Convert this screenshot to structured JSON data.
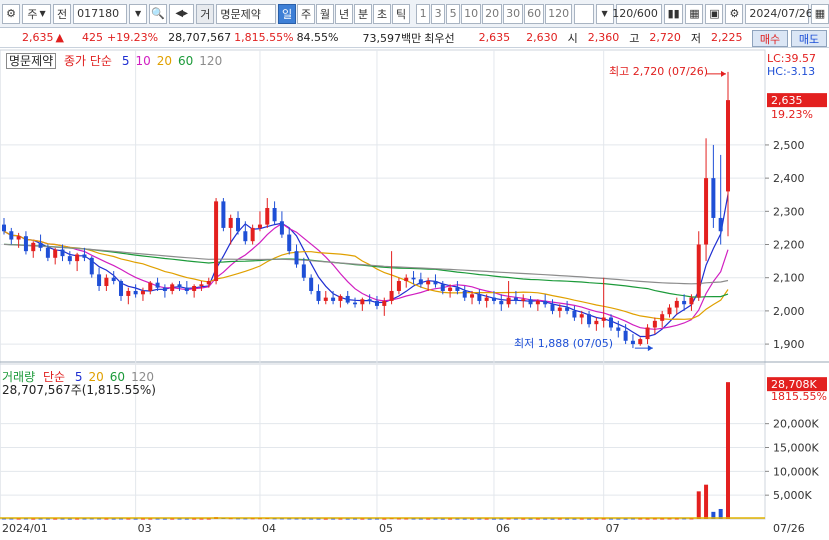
{
  "toolbar": {
    "market": "주",
    "type": "전",
    "code": "017180",
    "name_prefix": "거",
    "name": "명문제약",
    "periods": [
      "일",
      "주",
      "월",
      "년",
      "분",
      "초",
      "틱"
    ],
    "selected_period": "일",
    "intervals": [
      "1",
      "3",
      "5",
      "10",
      "20",
      "30",
      "60",
      "120"
    ],
    "count": "120/600",
    "date": "2024/07/26"
  },
  "quote": {
    "price": "2,635",
    "arrow": "▲",
    "change": "425",
    "change_pct": "+19.23%",
    "volume": "28,707,567",
    "volume_ratio": "1,815.55%",
    "turnover": "84.55%",
    "amount": "73,597백만",
    "ask_label": "최우선",
    "ask": "2,635",
    "bid": "2,630",
    "open_label": "시",
    "open": "2,360",
    "high_label": "고",
    "high": "2,720",
    "low_label": "저",
    "low": "2,225",
    "buy": "매수",
    "sell": "매도"
  },
  "price_panel": {
    "name": "명문제약",
    "legend_label": "종가 단순",
    "ma": [
      {
        "label": "5",
        "color": "#1f2fd1"
      },
      {
        "label": "10",
        "color": "#d11fc1"
      },
      {
        "label": "20",
        "color": "#e0a000"
      },
      {
        "label": "60",
        "color": "#1c9a3a"
      },
      {
        "label": "120",
        "color": "#8c8c8c"
      }
    ],
    "high_note": "최고 2,720 (07/26)",
    "low_note": "최저 1,888 (07/05)",
    "lc": "LC:39.57",
    "hc": "HC:-3.13",
    "current_price": "2,635",
    "current_pct": "19.23%"
  },
  "volume_panel": {
    "name": "거래량",
    "legend_label": "단순",
    "ma": [
      {
        "label": "5",
        "color": "#1f2fd1"
      },
      {
        "label": "20",
        "color": "#e0a000"
      },
      {
        "label": "60",
        "color": "#1c9a3a"
      },
      {
        "label": "120",
        "color": "#8c8c8c"
      }
    ],
    "last": "28,707,567주(1,815.55%)",
    "current": "28,708K",
    "current_pct": "1815.55%"
  },
  "x_axis": {
    "labels": [
      "2024/01",
      "03",
      "04",
      "05",
      "06",
      "07"
    ],
    "right_label": "07/26"
  },
  "chart_data": {
    "type": "candlestick",
    "price_axis": {
      "ticks": [
        1900,
        2000,
        2100,
        2200,
        2300,
        2400,
        2500
      ],
      "tick_labels": [
        "1,900",
        "2,000",
        "2,100",
        "2,200",
        "2,300",
        "2,400",
        "2,500"
      ],
      "ylim": [
        1840,
        2780
      ]
    },
    "volume_axis": {
      "ticks": [
        5000,
        10000,
        15000,
        20000
      ],
      "tick_labels": [
        "5,000K",
        "10,000K",
        "15,000K",
        "20,000K"
      ],
      "ylim": [
        0,
        30000
      ]
    },
    "candles": [
      [
        2260,
        2280,
        2230,
        2240
      ],
      [
        2240,
        2250,
        2200,
        2215
      ],
      [
        2215,
        2235,
        2190,
        2225
      ],
      [
        2225,
        2240,
        2170,
        2180
      ],
      [
        2180,
        2210,
        2160,
        2205
      ],
      [
        2205,
        2230,
        2180,
        2190
      ],
      [
        2190,
        2200,
        2150,
        2160
      ],
      [
        2160,
        2190,
        2140,
        2185
      ],
      [
        2185,
        2200,
        2150,
        2165
      ],
      [
        2165,
        2180,
        2140,
        2150
      ],
      [
        2150,
        2175,
        2120,
        2170
      ],
      [
        2170,
        2190,
        2150,
        2160
      ],
      [
        2160,
        2165,
        2100,
        2110
      ],
      [
        2110,
        2130,
        2060,
        2075
      ],
      [
        2075,
        2110,
        2060,
        2100
      ],
      [
        2100,
        2120,
        2080,
        2090
      ],
      [
        2090,
        2095,
        2030,
        2045
      ],
      [
        2045,
        2070,
        2020,
        2060
      ],
      [
        2060,
        2080,
        2040,
        2050
      ],
      [
        2050,
        2070,
        2030,
        2060
      ],
      [
        2060,
        2090,
        2050,
        2085
      ],
      [
        2085,
        2100,
        2060,
        2070
      ],
      [
        2070,
        2080,
        2040,
        2060
      ],
      [
        2060,
        2085,
        2050,
        2080
      ],
      [
        2080,
        2090,
        2060,
        2070
      ],
      [
        2070,
        2090,
        2050,
        2060
      ],
      [
        2060,
        2080,
        2040,
        2075
      ],
      [
        2075,
        2090,
        2060,
        2080
      ],
      [
        2080,
        2100,
        2070,
        2090
      ],
      [
        2090,
        2340,
        2080,
        2330
      ],
      [
        2330,
        2340,
        2240,
        2250
      ],
      [
        2250,
        2290,
        2200,
        2280
      ],
      [
        2280,
        2300,
        2230,
        2240
      ],
      [
        2240,
        2270,
        2200,
        2210
      ],
      [
        2210,
        2260,
        2200,
        2250
      ],
      [
        2250,
        2300,
        2240,
        2260
      ],
      [
        2260,
        2340,
        2250,
        2310
      ],
      [
        2310,
        2330,
        2260,
        2270
      ],
      [
        2270,
        2300,
        2220,
        2230
      ],
      [
        2230,
        2250,
        2170,
        2180
      ],
      [
        2180,
        2200,
        2130,
        2140
      ],
      [
        2140,
        2160,
        2090,
        2100
      ],
      [
        2100,
        2110,
        2050,
        2060
      ],
      [
        2060,
        2080,
        2020,
        2030
      ],
      [
        2030,
        2060,
        2020,
        2040
      ],
      [
        2040,
        2060,
        2020,
        2030
      ],
      [
        2030,
        2050,
        2010,
        2045
      ],
      [
        2045,
        2060,
        2020,
        2025
      ],
      [
        2025,
        2040,
        2010,
        2020
      ],
      [
        2020,
        2040,
        2000,
        2035
      ],
      [
        2035,
        2050,
        2020,
        2030
      ],
      [
        2030,
        2045,
        2005,
        2015
      ],
      [
        2015,
        2040,
        1985,
        2030
      ],
      [
        2030,
        2180,
        2020,
        2060
      ],
      [
        2060,
        2100,
        2050,
        2090
      ],
      [
        2090,
        2110,
        2070,
        2100
      ],
      [
        2100,
        2120,
        2080,
        2095
      ],
      [
        2095,
        2115,
        2070,
        2080
      ],
      [
        2080,
        2100,
        2060,
        2090
      ],
      [
        2090,
        2110,
        2070,
        2080
      ],
      [
        2080,
        2090,
        2050,
        2060
      ],
      [
        2060,
        2080,
        2040,
        2070
      ],
      [
        2070,
        2090,
        2050,
        2060
      ],
      [
        2060,
        2075,
        2030,
        2040
      ],
      [
        2040,
        2060,
        2020,
        2050
      ],
      [
        2050,
        2065,
        2020,
        2030
      ],
      [
        2030,
        2050,
        2010,
        2040
      ],
      [
        2040,
        2060,
        2020,
        2030
      ],
      [
        2030,
        2050,
        2000,
        2020
      ],
      [
        2020,
        2090,
        2010,
        2040
      ],
      [
        2040,
        2060,
        2020,
        2030
      ],
      [
        2030,
        2050,
        2010,
        2035
      ],
      [
        2035,
        2045,
        2010,
        2020
      ],
      [
        2020,
        2035,
        2000,
        2030
      ],
      [
        2030,
        2050,
        2010,
        2020
      ],
      [
        2020,
        2035,
        1990,
        2000
      ],
      [
        2000,
        2020,
        1980,
        2010
      ],
      [
        2010,
        2030,
        1990,
        2000
      ],
      [
        2000,
        2015,
        1970,
        1980
      ],
      [
        1980,
        2000,
        1960,
        1990
      ],
      [
        1990,
        2000,
        1950,
        1960
      ],
      [
        1960,
        1980,
        1940,
        1970
      ],
      [
        1970,
        2100,
        1950,
        1980
      ],
      [
        1980,
        1990,
        1940,
        1950
      ],
      [
        1950,
        1970,
        1920,
        1940
      ],
      [
        1940,
        1960,
        1900,
        1910
      ],
      [
        1910,
        1930,
        1888,
        1900
      ],
      [
        1900,
        1920,
        1895,
        1915
      ],
      [
        1915,
        1960,
        1900,
        1950
      ],
      [
        1950,
        1980,
        1930,
        1970
      ],
      [
        1970,
        2000,
        1950,
        1990
      ],
      [
        1990,
        2020,
        1980,
        2010
      ],
      [
        2010,
        2040,
        1990,
        2030
      ],
      [
        2030,
        2050,
        2000,
        2020
      ],
      [
        2020,
        2050,
        2000,
        2040
      ],
      [
        2040,
        2240,
        2030,
        2200
      ],
      [
        2200,
        2520,
        2150,
        2400
      ],
      [
        2400,
        2500,
        2250,
        2280
      ],
      [
        2280,
        2470,
        2200,
        2240
      ],
      [
        2360,
        2720,
        2225,
        2635
      ]
    ],
    "volume": [
      120,
      110,
      100,
      130,
      90,
      110,
      100,
      95,
      105,
      90,
      100,
      110,
      130,
      120,
      100,
      95,
      110,
      100,
      90,
      100,
      95,
      100,
      90,
      95,
      100,
      90,
      100,
      95,
      100,
      400,
      250,
      180,
      150,
      140,
      160,
      170,
      200,
      150,
      140,
      130,
      120,
      110,
      100,
      95,
      90,
      100,
      95,
      90,
      100,
      95,
      90,
      100,
      95,
      180,
      130,
      120,
      110,
      100,
      95,
      100,
      90,
      95,
      100,
      95,
      90,
      100,
      95,
      90,
      100,
      110,
      100,
      95,
      90,
      100,
      95,
      90,
      100,
      95,
      90,
      100,
      95,
      90,
      110,
      100,
      95,
      90,
      120,
      110,
      100,
      120,
      110,
      130,
      120,
      140,
      130,
      5800,
      7200,
      1500,
      2100,
      28708
    ]
  }
}
